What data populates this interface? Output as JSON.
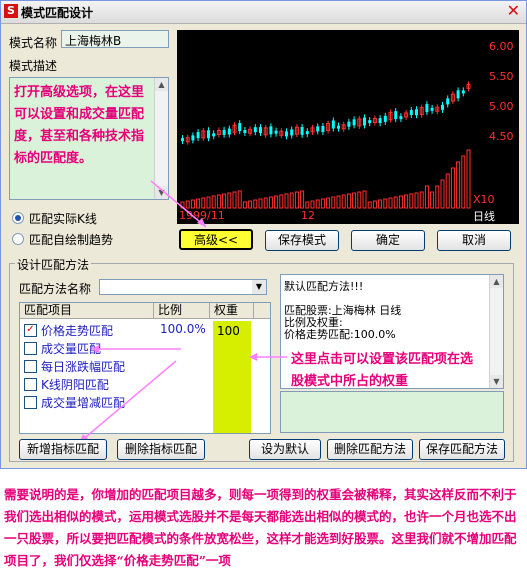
{
  "window": {
    "title": "模式匹配设计",
    "logo_char": "S",
    "close_glyph": "✕"
  },
  "form": {
    "name_label": "模式名称",
    "name_value": "上海梅林B",
    "desc_label": "模式描述",
    "desc_note": "打开高级选项，在这里可以设置和成交量匹配度，甚至和各种技术指标的匹配度。"
  },
  "radios": {
    "option1": "匹配实际K线",
    "option2": "匹配自绘制趋势",
    "selected": "option1"
  },
  "chart": {
    "x_start_label": "1999/11",
    "x_mid_label": "12",
    "period_label": "日线",
    "vol_scale_label": "X10",
    "y_ticks": [
      "6.00",
      "5.50",
      "5.00",
      "4.50"
    ],
    "up_color": "#00ffff",
    "down_color": "#ff3030"
  },
  "buttons": {
    "advanced": "高级<<",
    "save_pattern": "保存模式",
    "ok": "确定",
    "cancel": "取消",
    "add_indicator": "新增指标匹配",
    "delete_indicator": "删除指标匹配",
    "set_default": "设为默认",
    "delete_method": "删除匹配方法",
    "save_method": "保存匹配方法"
  },
  "match_design": {
    "group_label": "设计匹配方法",
    "method_name_label": "匹配方法名称",
    "method_name_value": "",
    "columns": [
      "匹配项目",
      "比例",
      "权重"
    ],
    "rows": [
      {
        "checked": true,
        "item": "价格走势匹配",
        "ratio": "100.0%",
        "weight": "100"
      },
      {
        "checked": false,
        "item": "成交量匹配",
        "ratio": "",
        "weight": ""
      },
      {
        "checked": false,
        "item": "每日涨跌幅匹配",
        "ratio": "",
        "weight": ""
      },
      {
        "checked": false,
        "item": "K线阴阳匹配",
        "ratio": "",
        "weight": ""
      },
      {
        "checked": false,
        "item": "成交量增减匹配",
        "ratio": "",
        "weight": ""
      }
    ],
    "weight_color": "#d6ef00"
  },
  "description": {
    "line1": "默认匹配方法!!!",
    "line2": "匹配股票:上海梅林  日线",
    "line3": "比例及权重:",
    "line4": "价格走势匹配:100.0%"
  },
  "annotations": {
    "weight_hint": "这里点击可以设置该匹配项在选股模式中所占的权重",
    "bottom_note": "需要说明的是，你增加的匹配项目越多，则每一项得到的权重会被稀释，其实这样反而不利于我们选出相似的模式，运用模式选股并不是每天都能选出相似的模式的，也许一个月也选不出一只股票，所以要把匹配模式的条件放宽松些，这样才能选到好股票。这里我们就不增加匹配项目了，我们仅选择“价格走势匹配”一项"
  },
  "colors": {
    "annotation": "#e6007a",
    "note_bg": "#d9f2d9",
    "highlight_button": "#ffff33"
  }
}
